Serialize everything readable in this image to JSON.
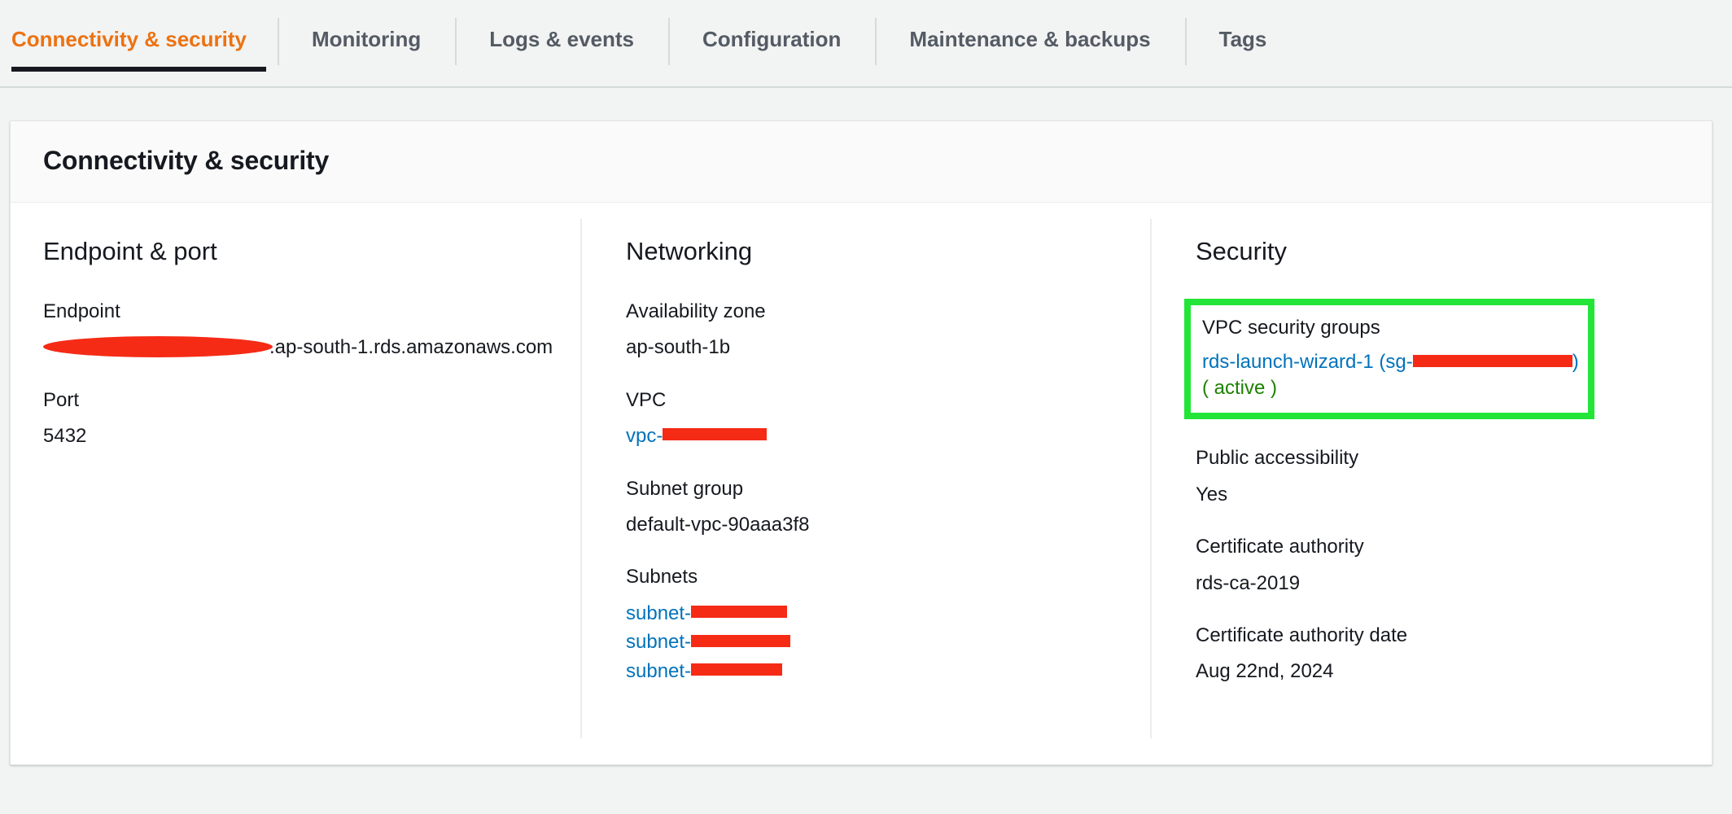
{
  "tabs": [
    {
      "label": "Connectivity & security",
      "active": true
    },
    {
      "label": "Monitoring",
      "active": false
    },
    {
      "label": "Logs & events",
      "active": false
    },
    {
      "label": "Configuration",
      "active": false
    },
    {
      "label": "Maintenance & backups",
      "active": false
    },
    {
      "label": "Tags",
      "active": false
    }
  ],
  "card": {
    "title": "Connectivity & security"
  },
  "endpoint_port": {
    "heading": "Endpoint & port",
    "endpoint_label": "Endpoint",
    "endpoint_value_visible": ".ap-south-1.rds.amazonaws.com",
    "endpoint_redacted": true,
    "port_label": "Port",
    "port_value": "5432"
  },
  "networking": {
    "heading": "Networking",
    "availability_zone_label": "Availability zone",
    "availability_zone_value": "ap-south-1b",
    "vpc_label": "VPC",
    "vpc_value_prefix": "vpc-",
    "vpc_redacted": true,
    "subnet_group_label": "Subnet group",
    "subnet_group_value": "default-vpc-90aaa3f8",
    "subnets_label": "Subnets",
    "subnets": [
      {
        "prefix": "subnet-",
        "redacted": true,
        "redact_width": 118
      },
      {
        "prefix": "subnet-",
        "redacted": true,
        "redact_width": 122
      },
      {
        "prefix": "subnet-",
        "redacted": true,
        "redact_width": 112
      }
    ]
  },
  "security": {
    "heading": "Security",
    "vpc_security_groups_label": "VPC security groups",
    "security_group_name": "rds-launch-wizard-1 (sg-",
    "security_group_suffix": ")",
    "security_group_redacted": true,
    "security_group_status": "( active )",
    "public_accessibility_label": "Public accessibility",
    "public_accessibility_value": "Yes",
    "certificate_authority_label": "Certificate authority",
    "certificate_authority_value": "rds-ca-2019",
    "certificate_authority_date_label": "Certificate authority date",
    "certificate_authority_date_value": "Aug 22nd, 2024"
  },
  "colors": {
    "accent_orange": "#EC7211",
    "link_blue": "#0073BB",
    "active_green": "#1D8102",
    "highlight_green": "#22E538",
    "redaction_red": "#F52B16",
    "page_background": "#F2F3F3",
    "card_header_background": "#FAFAFA",
    "text_primary": "#16191F",
    "tab_inactive": "#545B64"
  }
}
